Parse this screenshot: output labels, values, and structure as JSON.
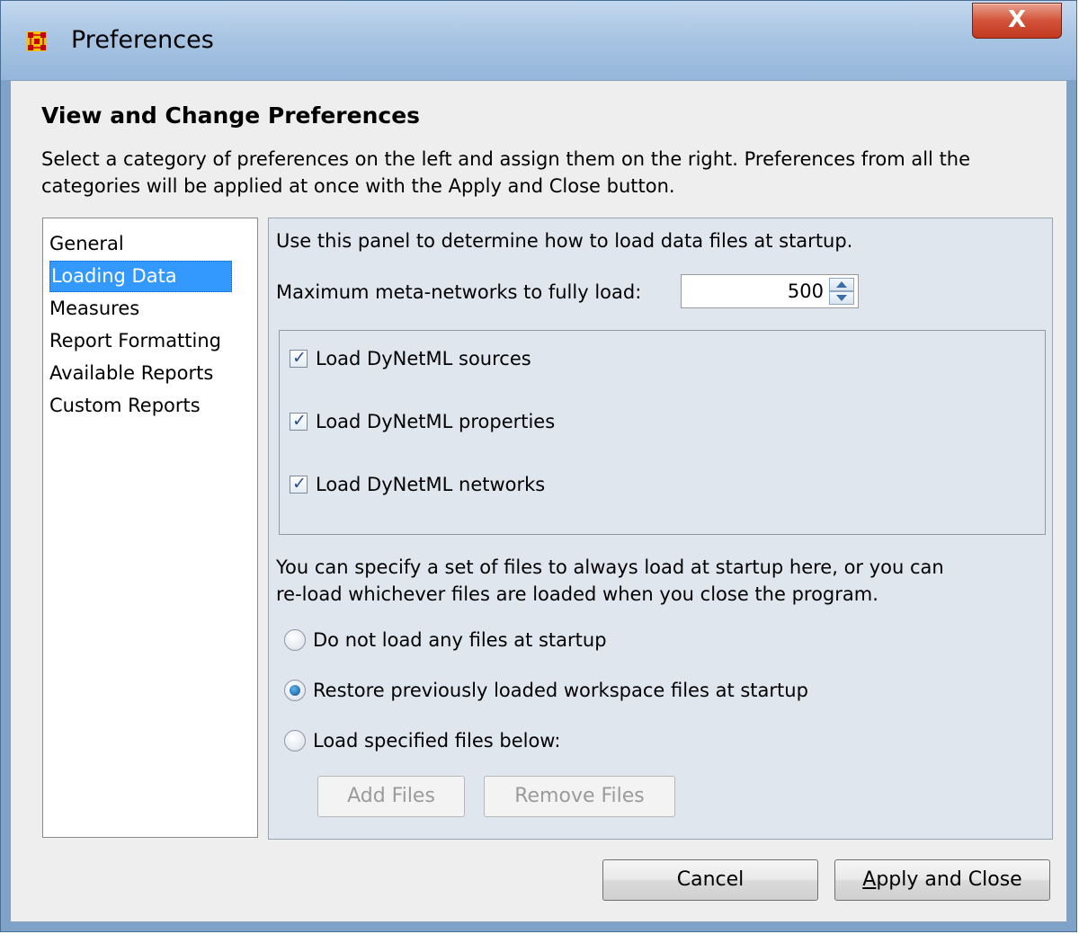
{
  "window": {
    "title": "Preferences",
    "close_glyph": "X"
  },
  "header": {
    "heading": "View and Change Preferences",
    "description": "Select a category of preferences on the left and assign them on the right. Preferences from all the categories will be applied at once with the Apply and Close button."
  },
  "categories": {
    "items": [
      "General",
      "Loading Data",
      "Measures",
      "Report Formatting",
      "Available Reports",
      "Custom Reports"
    ],
    "selected": "Loading Data"
  },
  "panel": {
    "intro": "Use this panel to determine how to load data files at startup.",
    "max_label": "Maximum meta-networks to fully load:",
    "max_value": "500",
    "checkboxes": [
      {
        "label": "Load DyNetML sources",
        "checked": true
      },
      {
        "label": "Load DyNetML properties",
        "checked": true
      },
      {
        "label": "Load DyNetML networks",
        "checked": true
      }
    ],
    "files_text_1": "You can specify a set of files to always load at startup here, or you can",
    "files_text_2": "re-load whichever files are loaded when you close the program.",
    "radios": [
      {
        "label": "Do not load any files at startup",
        "selected": false
      },
      {
        "label": "Restore previously loaded workspace files at startup",
        "selected": true
      },
      {
        "label": "Load specified files below:",
        "selected": false
      }
    ],
    "add_files": "Add Files",
    "remove_files": "Remove Files"
  },
  "footer": {
    "cancel": "Cancel",
    "apply_mnemonic": "A",
    "apply_rest": "pply and Close"
  },
  "icons": {
    "app": "network-grid-icon",
    "check": "check-icon"
  },
  "colors": {
    "selection": "#3399ff",
    "panel_bg": "#dfe6ee",
    "title_bar": "#a9c5e3",
    "close_button": "#d2533a"
  }
}
